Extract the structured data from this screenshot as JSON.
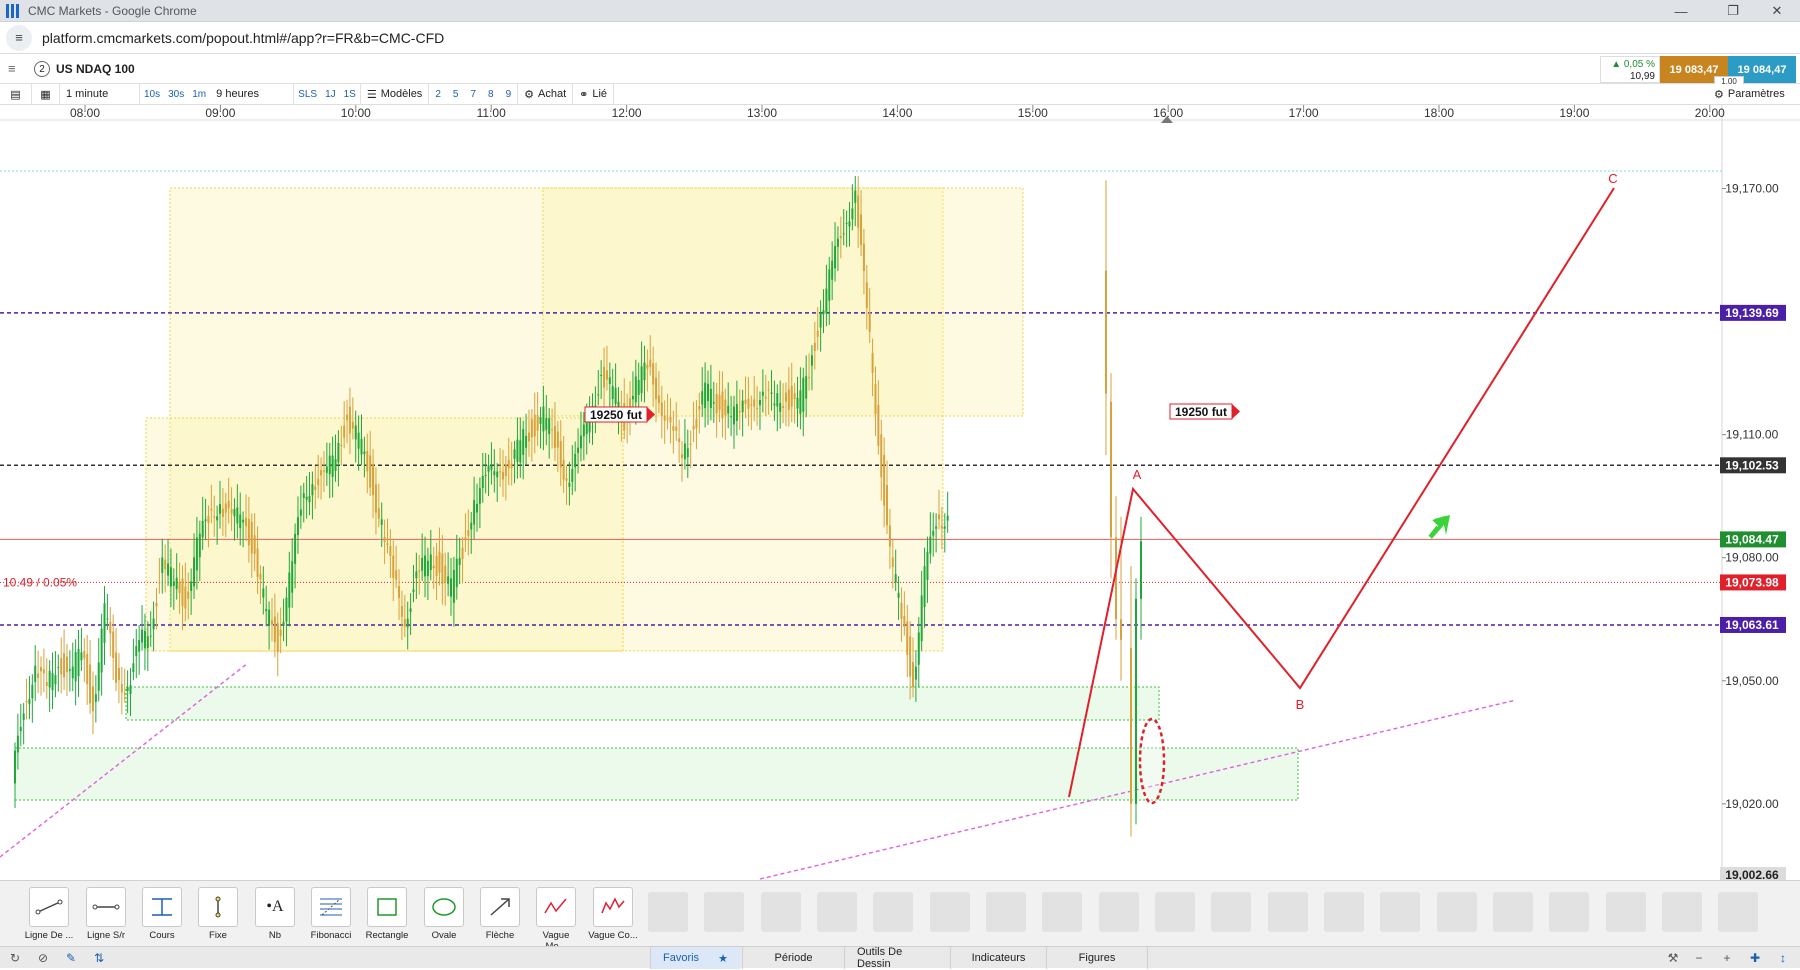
{
  "window": {
    "title": "CMC Markets - Google Chrome"
  },
  "browser": {
    "url": "platform.cmcmarkets.com/popout.html#/app?r=FR&b=CMC-CFD"
  },
  "instrument": {
    "number": "2",
    "name": "US NDAQ 100"
  },
  "quote": {
    "change_pct": "▲ 0,05 %",
    "change_abs": "10,99",
    "sell": "19 083,47",
    "buy": "19 084,47",
    "spread": "1,00"
  },
  "toolbar": {
    "interval": "1 minute",
    "intervals": [
      "10s",
      "30s",
      "1m"
    ],
    "period": "9 heures",
    "sizes": [
      "SLS",
      "1J",
      "1S"
    ],
    "models_label": "Modèles",
    "model_numbers": [
      "2",
      "5",
      "7",
      "8",
      "9"
    ],
    "buy_label": "Achat",
    "linked_label": "Lié",
    "settings_label": "Paramètres"
  },
  "chart_data": {
    "type": "candlestick",
    "x_axis": [
      "08:00",
      "09:00",
      "10:00",
      "11:00",
      "12:00",
      "13:00",
      "14:00",
      "15:00",
      "16:00",
      "17:00",
      "18:00",
      "19:00",
      "20:00"
    ],
    "y_ticks": [
      "19,170.00",
      "19,110.00",
      "19,080.00",
      "19,050.00",
      "19,020.00"
    ],
    "ylim": [
      19002.66,
      19185
    ],
    "horizontal_levels": [
      {
        "label": "19,139.69",
        "value": 19139.69,
        "color": "#4b1fa6"
      },
      {
        "label": "19,102.53",
        "value": 19102.53,
        "color": "#333333"
      },
      {
        "label": "19,084.47",
        "value": 19084.47,
        "color": "#1f8f2f"
      },
      {
        "label": "19,073.98",
        "value": 19073.98,
        "color": "#e0202a"
      },
      {
        "label": "19,063.61",
        "value": 19063.61,
        "color": "#4b1fa6"
      },
      {
        "label": "19,002.66",
        "value": 19002.66,
        "color": "#dddddd"
      }
    ],
    "ref_label": "10.49 / 0.05%",
    "flags": [
      "19250 fut",
      "19250 fut"
    ],
    "wave_labels": [
      "A",
      "B",
      "C"
    ],
    "series": [
      {
        "x": [
          0,
          15,
          30,
          45,
          60,
          75,
          90,
          105,
          120,
          135,
          150,
          165,
          180,
          195,
          210,
          225,
          240,
          255,
          270,
          285,
          300,
          315,
          330,
          345,
          360,
          375,
          390,
          405,
          420,
          435,
          450,
          465,
          480,
          495,
          510,
          525,
          540,
          555,
          570,
          585,
          600,
          615,
          630,
          645,
          660,
          675,
          690,
          705,
          720,
          735,
          750,
          765,
          780,
          795,
          810,
          825,
          840,
          855,
          870,
          885,
          900,
          915,
          930,
          945,
          960,
          975,
          990,
          1005,
          1020,
          1035,
          1050,
          1065,
          1080,
          1095,
          1110,
          1125,
          1140,
          1155,
          1170,
          1185,
          1200,
          1215,
          1230,
          1245,
          1260,
          1275,
          1290,
          1305,
          1320,
          1335,
          1350,
          1365,
          1380,
          1395,
          1410,
          1425,
          1440,
          1455,
          1470,
          1485
        ],
        "y": [
          19025,
          19045,
          19052,
          19048,
          19056,
          19050,
          19058,
          19044,
          19066,
          19052,
          19048,
          19058,
          19064,
          19078,
          19074,
          19070,
          19082,
          19090,
          19094,
          19088,
          19092,
          19080,
          19066,
          19060,
          19074,
          19092,
          19100,
          19098,
          19106,
          19114,
          19108,
          19100,
          19088,
          19074,
          19066,
          19074,
          19080,
          19078,
          19072,
          19082,
          19094,
          19098,
          19104,
          19100,
          19108,
          19112,
          19114,
          19108,
          19100,
          19104,
          19116,
          19124,
          19120,
          19114,
          19122,
          19126,
          19120,
          19110,
          19106,
          19112,
          19120,
          19118,
          19116,
          19114,
          19120,
          19118,
          19118,
          19120,
          19116,
          19126,
          19140,
          19150,
          19162,
          19168,
          19140,
          19110,
          19080,
          19066,
          19050,
          19075,
          19090,
          19090,
          19090,
          19090,
          19090,
          19090,
          19090,
          19090,
          19090,
          19090,
          19090,
          19090,
          19090,
          19090,
          19090,
          19090,
          19090,
          19090,
          19090,
          19090
        ]
      }
    ]
  },
  "drawing_tools": [
    "Ligne De ...",
    "Ligne S/r",
    "Cours",
    "Fixe",
    "Nb",
    "Fibonacci",
    "Rectangle",
    "Ovale",
    "Flèche",
    "Vague Mo...",
    "Vague Co..."
  ],
  "bottom_tabs": [
    "Favoris",
    "Période",
    "Outils De Dessin",
    "Indicateurs",
    "Figures"
  ]
}
